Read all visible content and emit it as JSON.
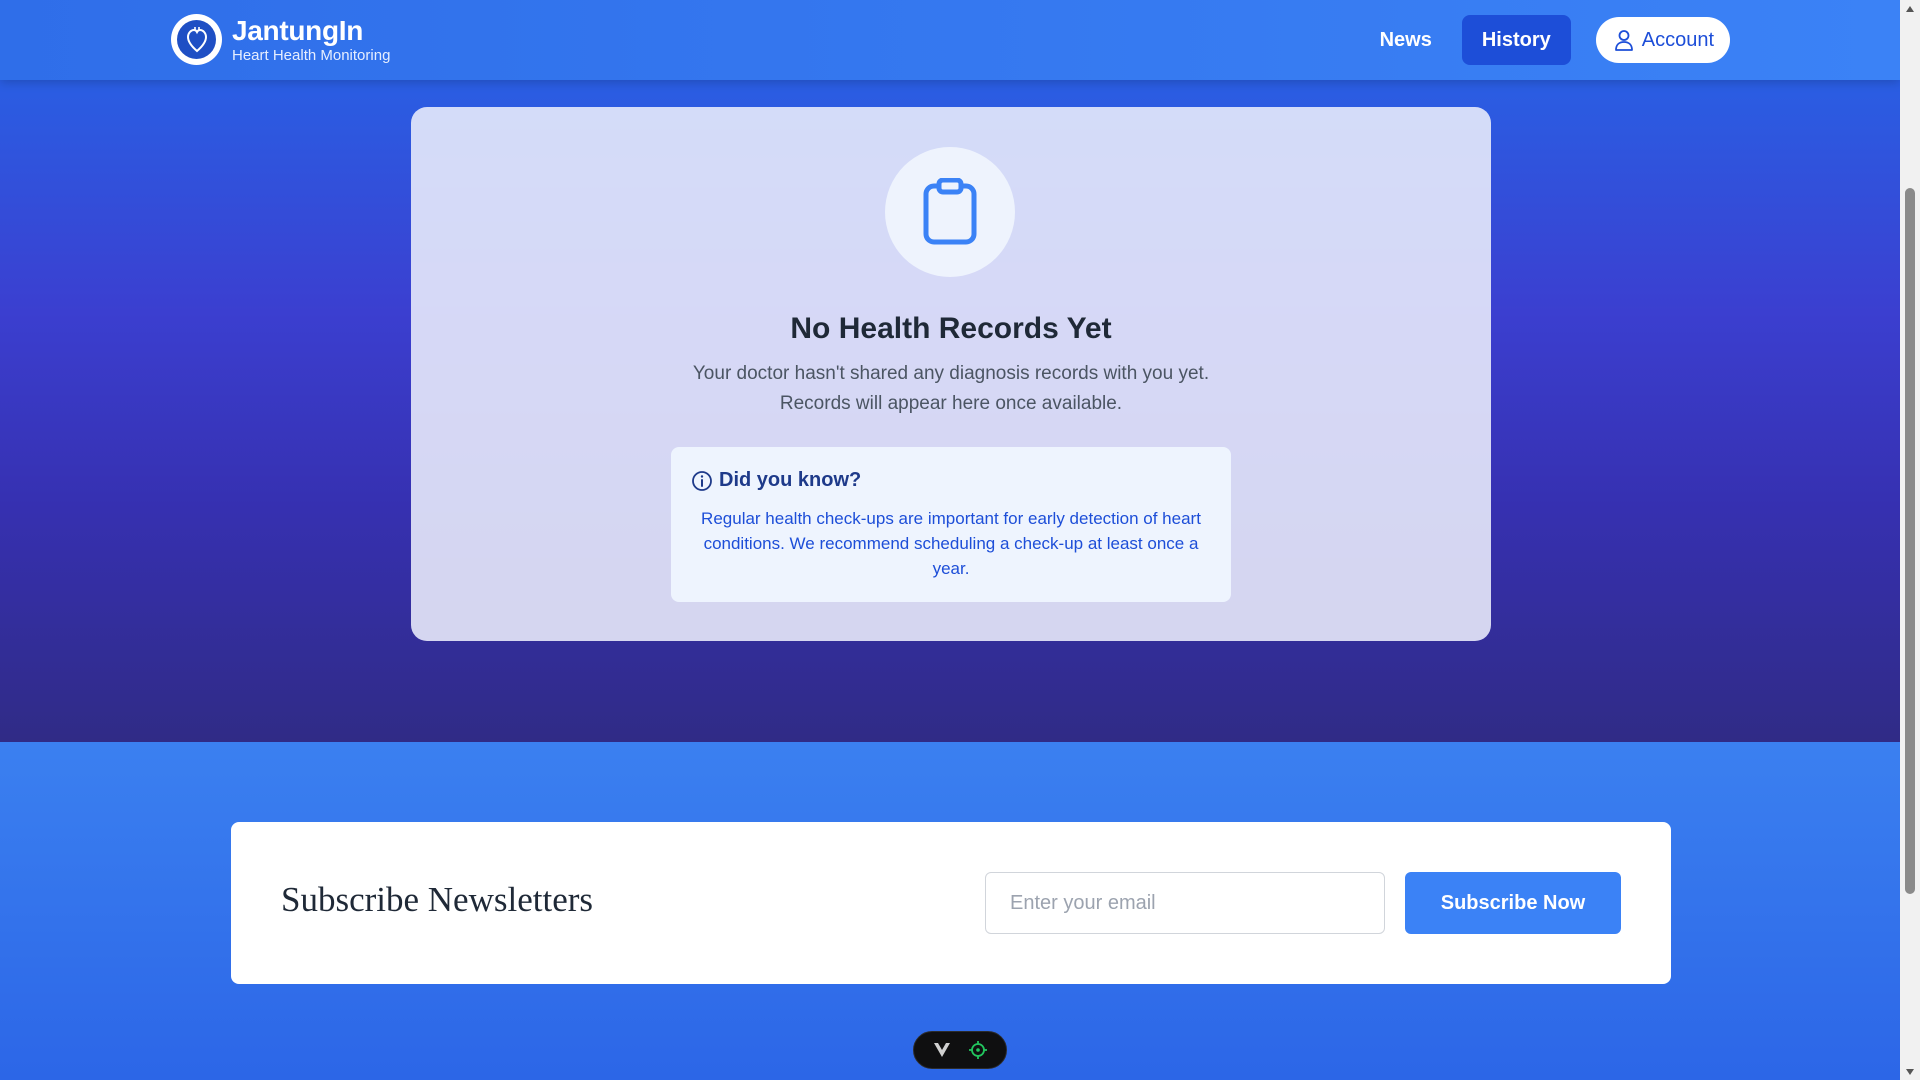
{
  "brand": {
    "title": "JantungIn",
    "subtitle": "Heart Health Monitoring"
  },
  "nav": {
    "news": "News",
    "history": "History",
    "account": "Account"
  },
  "empty_state": {
    "title": "No Health Records Yet",
    "desc_line1": "Your doctor hasn't shared any diagnosis records with you yet.",
    "desc_line2": "Records will appear here once available."
  },
  "tip": {
    "heading": "Did you know?",
    "text": "Regular health check-ups are important for early detection of heart conditions. We recommend scheduling a check-up at least once a year."
  },
  "newsletter": {
    "title": "Subscribe Newsletters",
    "email_placeholder": "Enter your email",
    "email_value": "",
    "button": "Subscribe Now"
  },
  "colors": {
    "primary": "#3b82f6",
    "active_nav": "#1d4ed8",
    "tip_text": "#1d4ed8"
  },
  "icons": {
    "logo": "heart-logo-icon",
    "account": "user-icon",
    "empty": "clipboard-icon",
    "tip": "info-icon",
    "toolbar": [
      "vue-logo-icon",
      "crosshair-icon"
    ]
  }
}
